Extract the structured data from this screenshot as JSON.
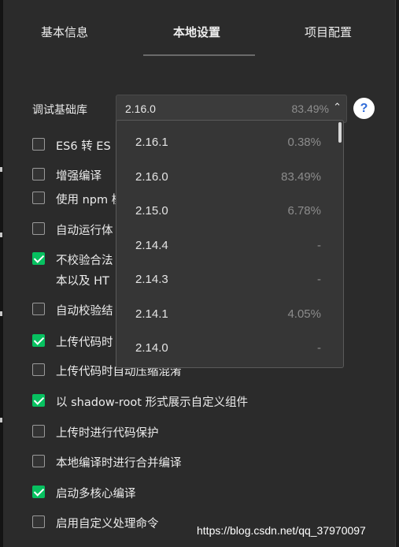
{
  "tabs": [
    {
      "label": "基本信息"
    },
    {
      "label": "本地设置"
    },
    {
      "label": "项目配置"
    }
  ],
  "debug_lib": {
    "label": "调试基础库",
    "selected_version": "2.16.0",
    "selected_percent": "83.49%",
    "chevron": "^",
    "help": "?"
  },
  "options": [
    {
      "label": "ES6 转 ES",
      "checked": false
    },
    {
      "label": "增强编译",
      "checked": false
    },
    {
      "label": "使用 npm 模",
      "checked": false
    },
    {
      "label": "自动运行体",
      "checked": false
    },
    {
      "label": "不校验合法",
      "line2": "本以及 HT",
      "checked": true
    },
    {
      "label": "自动校验结",
      "checked": false
    },
    {
      "label": "上传代码时",
      "checked": true
    },
    {
      "label": "上传代码时自动压缩混淆",
      "checked": false
    },
    {
      "label": "以 shadow-root 形式展示自定义组件",
      "checked": true
    },
    {
      "label": "上传时进行代码保护",
      "checked": false
    },
    {
      "label": "本地编译时进行合并编译",
      "checked": false
    },
    {
      "label": "启动多核心编译",
      "checked": true
    },
    {
      "label": "启用自定义处理命令",
      "checked": false
    }
  ],
  "dropdown": [
    {
      "version": "2.16.1",
      "percent": "0.38%"
    },
    {
      "version": "2.16.0",
      "percent": "83.49%"
    },
    {
      "version": "2.15.0",
      "percent": "6.78%"
    },
    {
      "version": "2.14.4",
      "percent": "-"
    },
    {
      "version": "2.14.3",
      "percent": "-"
    },
    {
      "version": "2.14.1",
      "percent": "4.05%"
    },
    {
      "version": "2.14.0",
      "percent": "-"
    }
  ],
  "watermark": "https://blog.csdn.net/qq_37970097",
  "colors": {
    "panel_bg": "#2b2b2b",
    "check_green": "#07c160",
    "help_blue": "#2f6bd8"
  }
}
